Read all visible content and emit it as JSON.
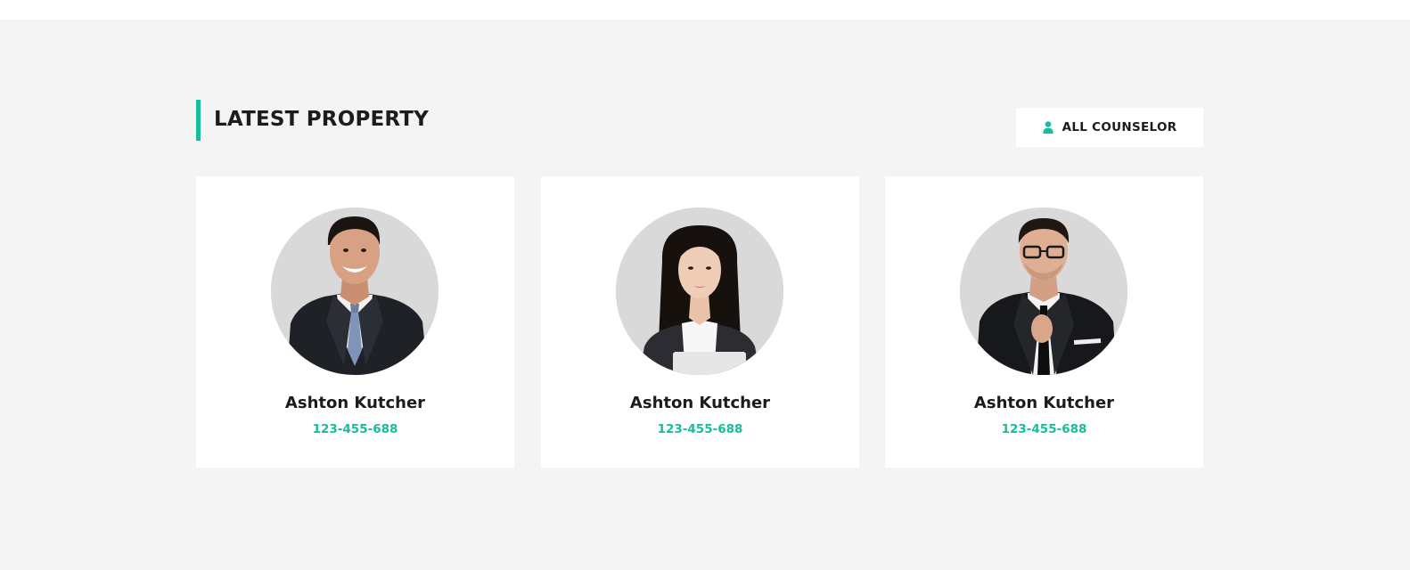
{
  "section": {
    "title": "LATEST PROPERTY",
    "all_button_label": "ALL COUNSELOR",
    "all_button_icon": "user-icon"
  },
  "colors": {
    "accent": "#1abc9c",
    "section_bg": "#f4f4f4",
    "card_bg": "#ffffff",
    "text_dark": "#1c1c1c",
    "avatar_bg": "#d9d9d9"
  },
  "counselors": [
    {
      "name": "Ashton Kutcher",
      "phone": "123-455-688",
      "photo": "man-smiling-blue-tie-photo"
    },
    {
      "name": "Ashton Kutcher",
      "phone": "123-455-688",
      "photo": "woman-long-hair-photo"
    },
    {
      "name": "Ashton Kutcher",
      "phone": "123-455-688",
      "photo": "man-glasses-black-tie-photo"
    }
  ]
}
